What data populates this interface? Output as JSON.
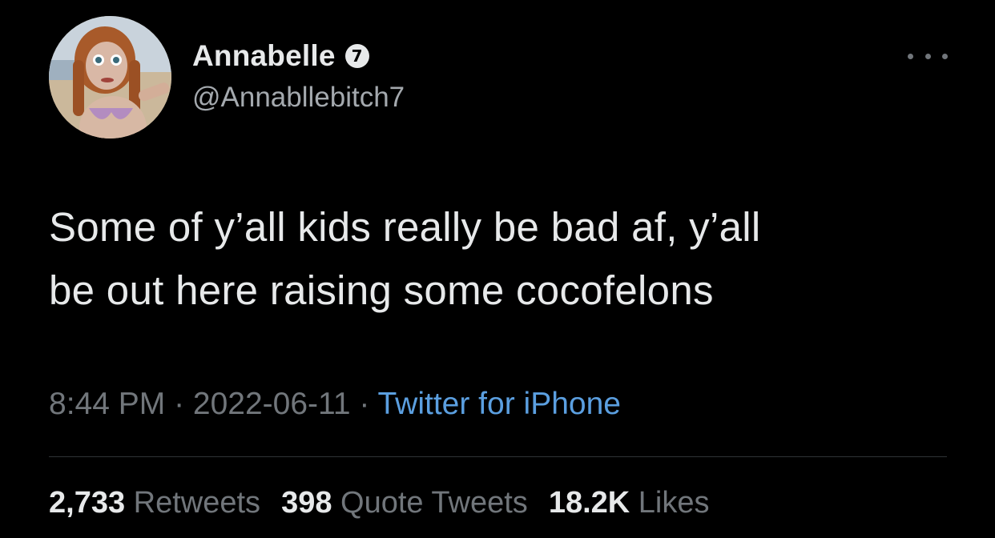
{
  "author": {
    "display_name": "Annabelle",
    "badge_glyph": "7",
    "handle": "@Annabllebitch7"
  },
  "tweet": {
    "text_line1": "Some of y’all kids really be bad af, y’all",
    "text_line2": "be out here raising some cocofelons"
  },
  "meta": {
    "time": "8:44 PM",
    "separator": " · ",
    "date": "2022-06-11",
    "source": "Twitter for iPhone"
  },
  "stats": {
    "retweets_count": "2,733",
    "retweets_label": "Retweets",
    "quotes_count": "398",
    "quotes_label": "Quote Tweets",
    "likes_count": "18.2K",
    "likes_label": "Likes"
  },
  "icons": {
    "more": "more-options-icon",
    "badge": "verified-badge-icon"
  },
  "colors": {
    "background": "#000000",
    "primary_text": "#e7e9ea",
    "secondary_text": "#71767b",
    "link": "#5b9fe0",
    "divider": "#2f3336"
  }
}
